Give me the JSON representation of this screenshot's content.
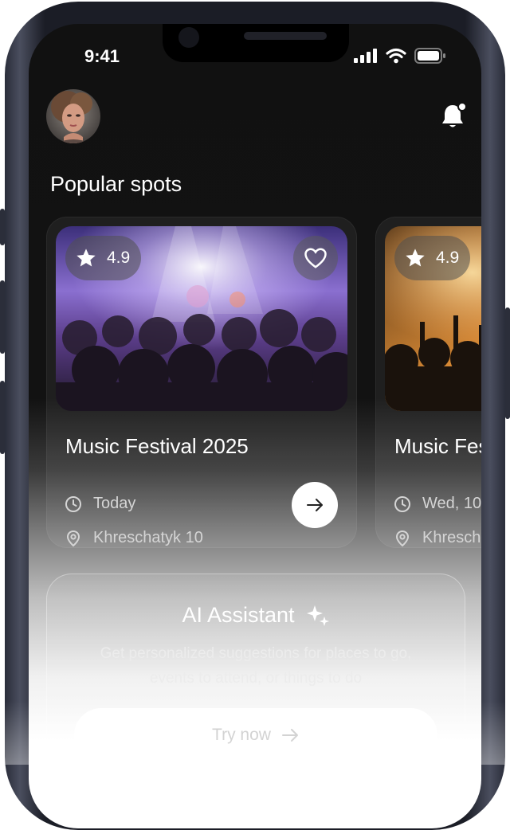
{
  "status_bar": {
    "time": "9:41"
  },
  "header": {
    "avatar_icon": "profile-avatar",
    "notification_icon": "bell-icon"
  },
  "section": {
    "title": "Popular spots"
  },
  "cards": [
    {
      "rating": "4.9",
      "title": "Music Festival 2025",
      "date": "Today",
      "location": "Khreschatyk 10"
    },
    {
      "rating": "4.9",
      "title": "Music Fes",
      "date": "Wed, 10.",
      "location": "Khrescha"
    }
  ],
  "ai_assistant": {
    "title": "AI Assistant",
    "description_line1": "Get personalized suggestions for places to go,",
    "description_line2": "events to attend, or things to do",
    "button_label": "Try now"
  },
  "colors": {
    "background": "#111111",
    "accent": "#ffffff"
  }
}
